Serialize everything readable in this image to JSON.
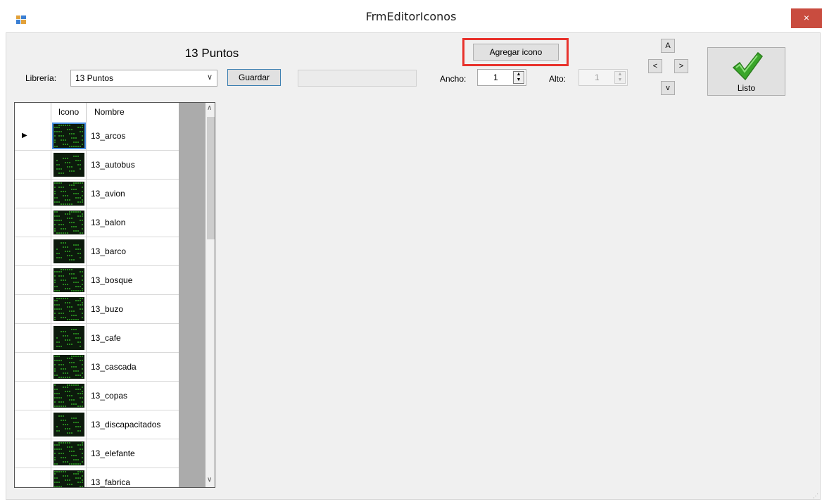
{
  "window": {
    "title": "FrmEditorIconos",
    "close_glyph": "×"
  },
  "library": {
    "heading": "13 Puntos",
    "label": "Librería:",
    "selected": "13 Puntos",
    "save_label": "Guardar"
  },
  "toolbar": {
    "add_icon_label": "Agregar icono",
    "width_label": "Ancho:",
    "width_value": "1",
    "height_label": "Alto:",
    "height_value": "1"
  },
  "nav": {
    "up": "A",
    "left": "<",
    "right": ">",
    "down": "v"
  },
  "done": {
    "label": "Listo",
    "icon": "checkmark-icon"
  },
  "grid": {
    "columns": [
      "Icono",
      "Nombre"
    ],
    "rows": [
      {
        "name": "13_arcos",
        "selected": true
      },
      {
        "name": "13_autobus"
      },
      {
        "name": "13_avion"
      },
      {
        "name": "13_balon"
      },
      {
        "name": "13_barco"
      },
      {
        "name": "13_bosque"
      },
      {
        "name": "13_buzo"
      },
      {
        "name": "13_cafe"
      },
      {
        "name": "13_cascada"
      },
      {
        "name": "13_copas"
      },
      {
        "name": "13_discapacitados"
      },
      {
        "name": "13_elefante"
      },
      {
        "name": "13_fabrica"
      }
    ]
  },
  "colors": {
    "highlight": "#e8322c",
    "led_green": "#39d12a",
    "check_green": "#3aa62a"
  }
}
